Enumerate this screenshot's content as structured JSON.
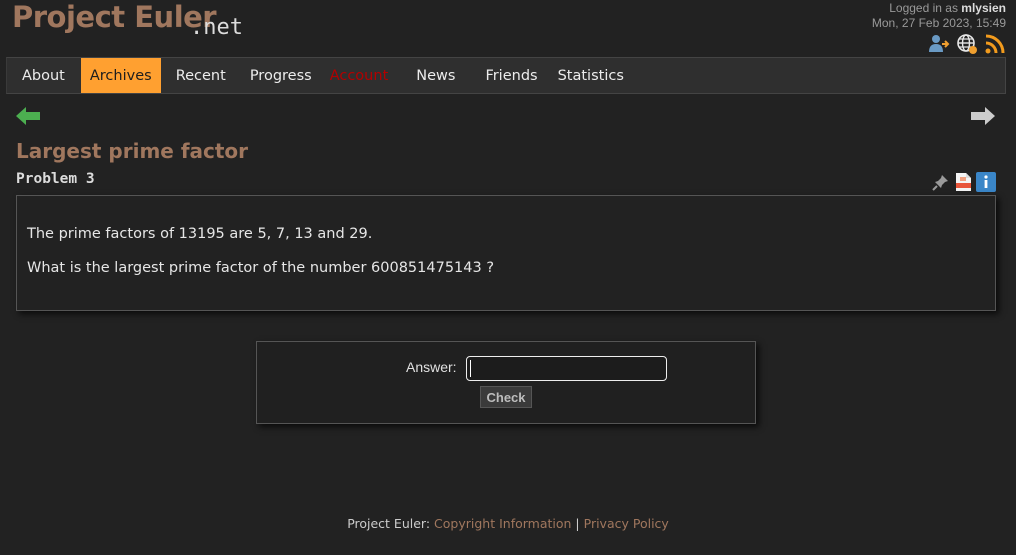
{
  "header": {
    "logo_text": "Project Euler",
    "logo_suffix": ".net",
    "logged_in_prefix": "Logged in as ",
    "username": "mlysien",
    "datetime": "Mon, 27 Feb 2023, 15:49",
    "icons": [
      "user-logout-icon",
      "globe-icon",
      "rss-icon"
    ]
  },
  "nav": {
    "items": [
      {
        "label": "About"
      },
      {
        "label": "Archives"
      },
      {
        "label": "Recent"
      },
      {
        "label": "Progress"
      },
      {
        "label": "Account"
      },
      {
        "label": "News"
      },
      {
        "label": "Friends"
      },
      {
        "label": "Statistics"
      }
    ],
    "active_index": 1,
    "active_color": "#ffa030"
  },
  "problem": {
    "title": "Largest prime factor",
    "number_label": "Problem 3",
    "paragraphs": [
      "The prime factors of 13195 are 5, 7, 13 and 29.",
      "What is the largest prime factor of the number 600851475143 ?"
    ],
    "icons": [
      "pin-icon",
      "pdf-icon",
      "info-icon"
    ]
  },
  "answer_form": {
    "label": "Answer:",
    "value": "",
    "button_label": "Check"
  },
  "footer": {
    "prefix": "Project Euler: ",
    "copyright_link": "Copyright Information",
    "separator": " | ",
    "privacy_link": "Privacy Policy"
  },
  "colors": {
    "accent": "#a0775e",
    "background": "#222222",
    "account": "#b20000",
    "arrow_prev": "#4caf50",
    "arrow_next": "#cccccc"
  }
}
